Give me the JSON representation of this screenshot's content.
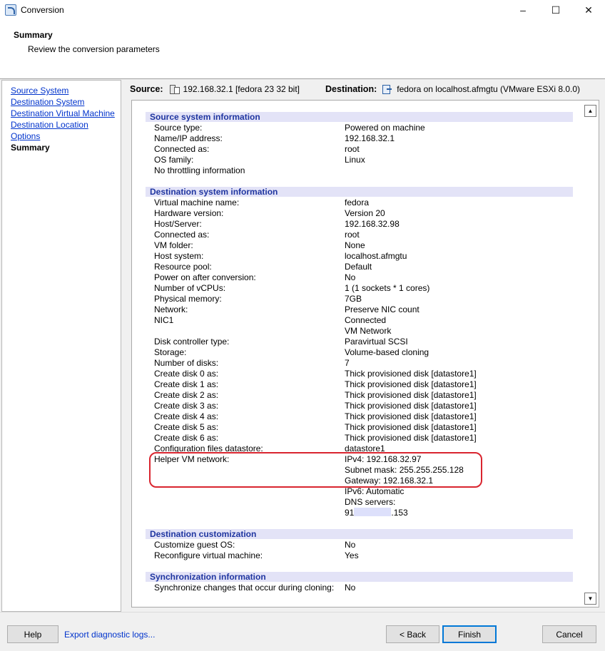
{
  "window": {
    "title": "Conversion",
    "minimize": "–",
    "maximize": "☐",
    "close": "✕"
  },
  "header": {
    "title": "Summary",
    "subtitle": "Review the conversion parameters"
  },
  "nav": {
    "items": [
      "Source System",
      "Destination System",
      "Destination Virtual Machine",
      "Destination Location",
      "Options"
    ],
    "current": "Summary"
  },
  "source": {
    "label": "Source:",
    "value": "192.168.32.1 [fedora 23 32 bit]"
  },
  "destination": {
    "label": "Destination:",
    "value": "fedora on localhost.afmgtu (VMware ESXi 8.0.0)"
  },
  "sections": {
    "source_info": "Source system information",
    "dest_info": "Destination system information",
    "dest_custom": "Destination customization",
    "sync_info": "Synchronization information"
  },
  "source_rows": [
    {
      "k": "Source type:",
      "v": "Powered on machine"
    },
    {
      "k": "Name/IP address:",
      "v": "192.168.32.1"
    },
    {
      "k": "Connected as:",
      "v": "root"
    },
    {
      "k": "OS family:",
      "v": "Linux"
    },
    {
      "k": "No throttling information",
      "v": ""
    }
  ],
  "dest_rows": [
    {
      "k": "Virtual machine name:",
      "v": "fedora"
    },
    {
      "k": "Hardware version:",
      "v": "Version 20"
    },
    {
      "k": "Host/Server:",
      "v": "192.168.32.98"
    },
    {
      "k": "Connected as:",
      "v": "root"
    },
    {
      "k": "VM folder:",
      "v": "None"
    },
    {
      "k": "Host system:",
      "v": "localhost.afmgtu"
    },
    {
      "k": "Resource pool:",
      "v": "Default"
    },
    {
      "k": "Power on after conversion:",
      "v": "No"
    },
    {
      "k": "Number of vCPUs:",
      "v": "1 (1 sockets * 1 cores)"
    },
    {
      "k": "Physical memory:",
      "v": "7GB"
    },
    {
      "k": "Network:",
      "v": "Preserve NIC count"
    },
    {
      "k": "NIC1",
      "v": "Connected"
    },
    {
      "k": "",
      "v": "VM Network"
    },
    {
      "k": "Disk controller type:",
      "v": "Paravirtual SCSI"
    },
    {
      "k": "Storage:",
      "v": "Volume-based cloning"
    },
    {
      "k": "Number of disks:",
      "v": "7"
    },
    {
      "k": "Create disk 0 as:",
      "v": "Thick provisioned disk [datastore1]"
    },
    {
      "k": "Create disk 1 as:",
      "v": "Thick provisioned disk [datastore1]"
    },
    {
      "k": "Create disk 2 as:",
      "v": "Thick provisioned disk [datastore1]"
    },
    {
      "k": "Create disk 3 as:",
      "v": "Thick provisioned disk [datastore1]"
    },
    {
      "k": "Create disk 4 as:",
      "v": "Thick provisioned disk [datastore1]"
    },
    {
      "k": "Create disk 5 as:",
      "v": "Thick provisioned disk [datastore1]"
    },
    {
      "k": "Create disk 6 as:",
      "v": "Thick provisioned disk [datastore1]"
    },
    {
      "k": "Configuration files datastore:",
      "v": "datastore1"
    },
    {
      "k": "Helper VM network:",
      "v": "IPv4: 192.168.32.97"
    },
    {
      "k": "",
      "v": "Subnet mask: 255.255.255.128"
    },
    {
      "k": "",
      "v": "Gateway: 192.168.32.1"
    },
    {
      "k": "",
      "v": "IPv6: Automatic"
    },
    {
      "k": "",
      "v": "DNS servers:"
    }
  ],
  "dns": {
    "prefix": "91",
    "suffix": ".153"
  },
  "custom_rows": [
    {
      "k": "Customize guest OS:",
      "v": "No"
    },
    {
      "k": "Reconfigure virtual machine:",
      "v": "Yes"
    }
  ],
  "sync_rows": [
    {
      "k": "Synchronize changes that occur during cloning:",
      "v": "No"
    }
  ],
  "footer": {
    "help": "Help",
    "export": "Export diagnostic logs...",
    "back": "< Back",
    "finish": "Finish",
    "cancel": "Cancel"
  },
  "colors": {
    "section_bg": "#e3e3f7",
    "section_text": "#1f35a0",
    "highlight": "#d9252f",
    "link": "#0033cc"
  }
}
